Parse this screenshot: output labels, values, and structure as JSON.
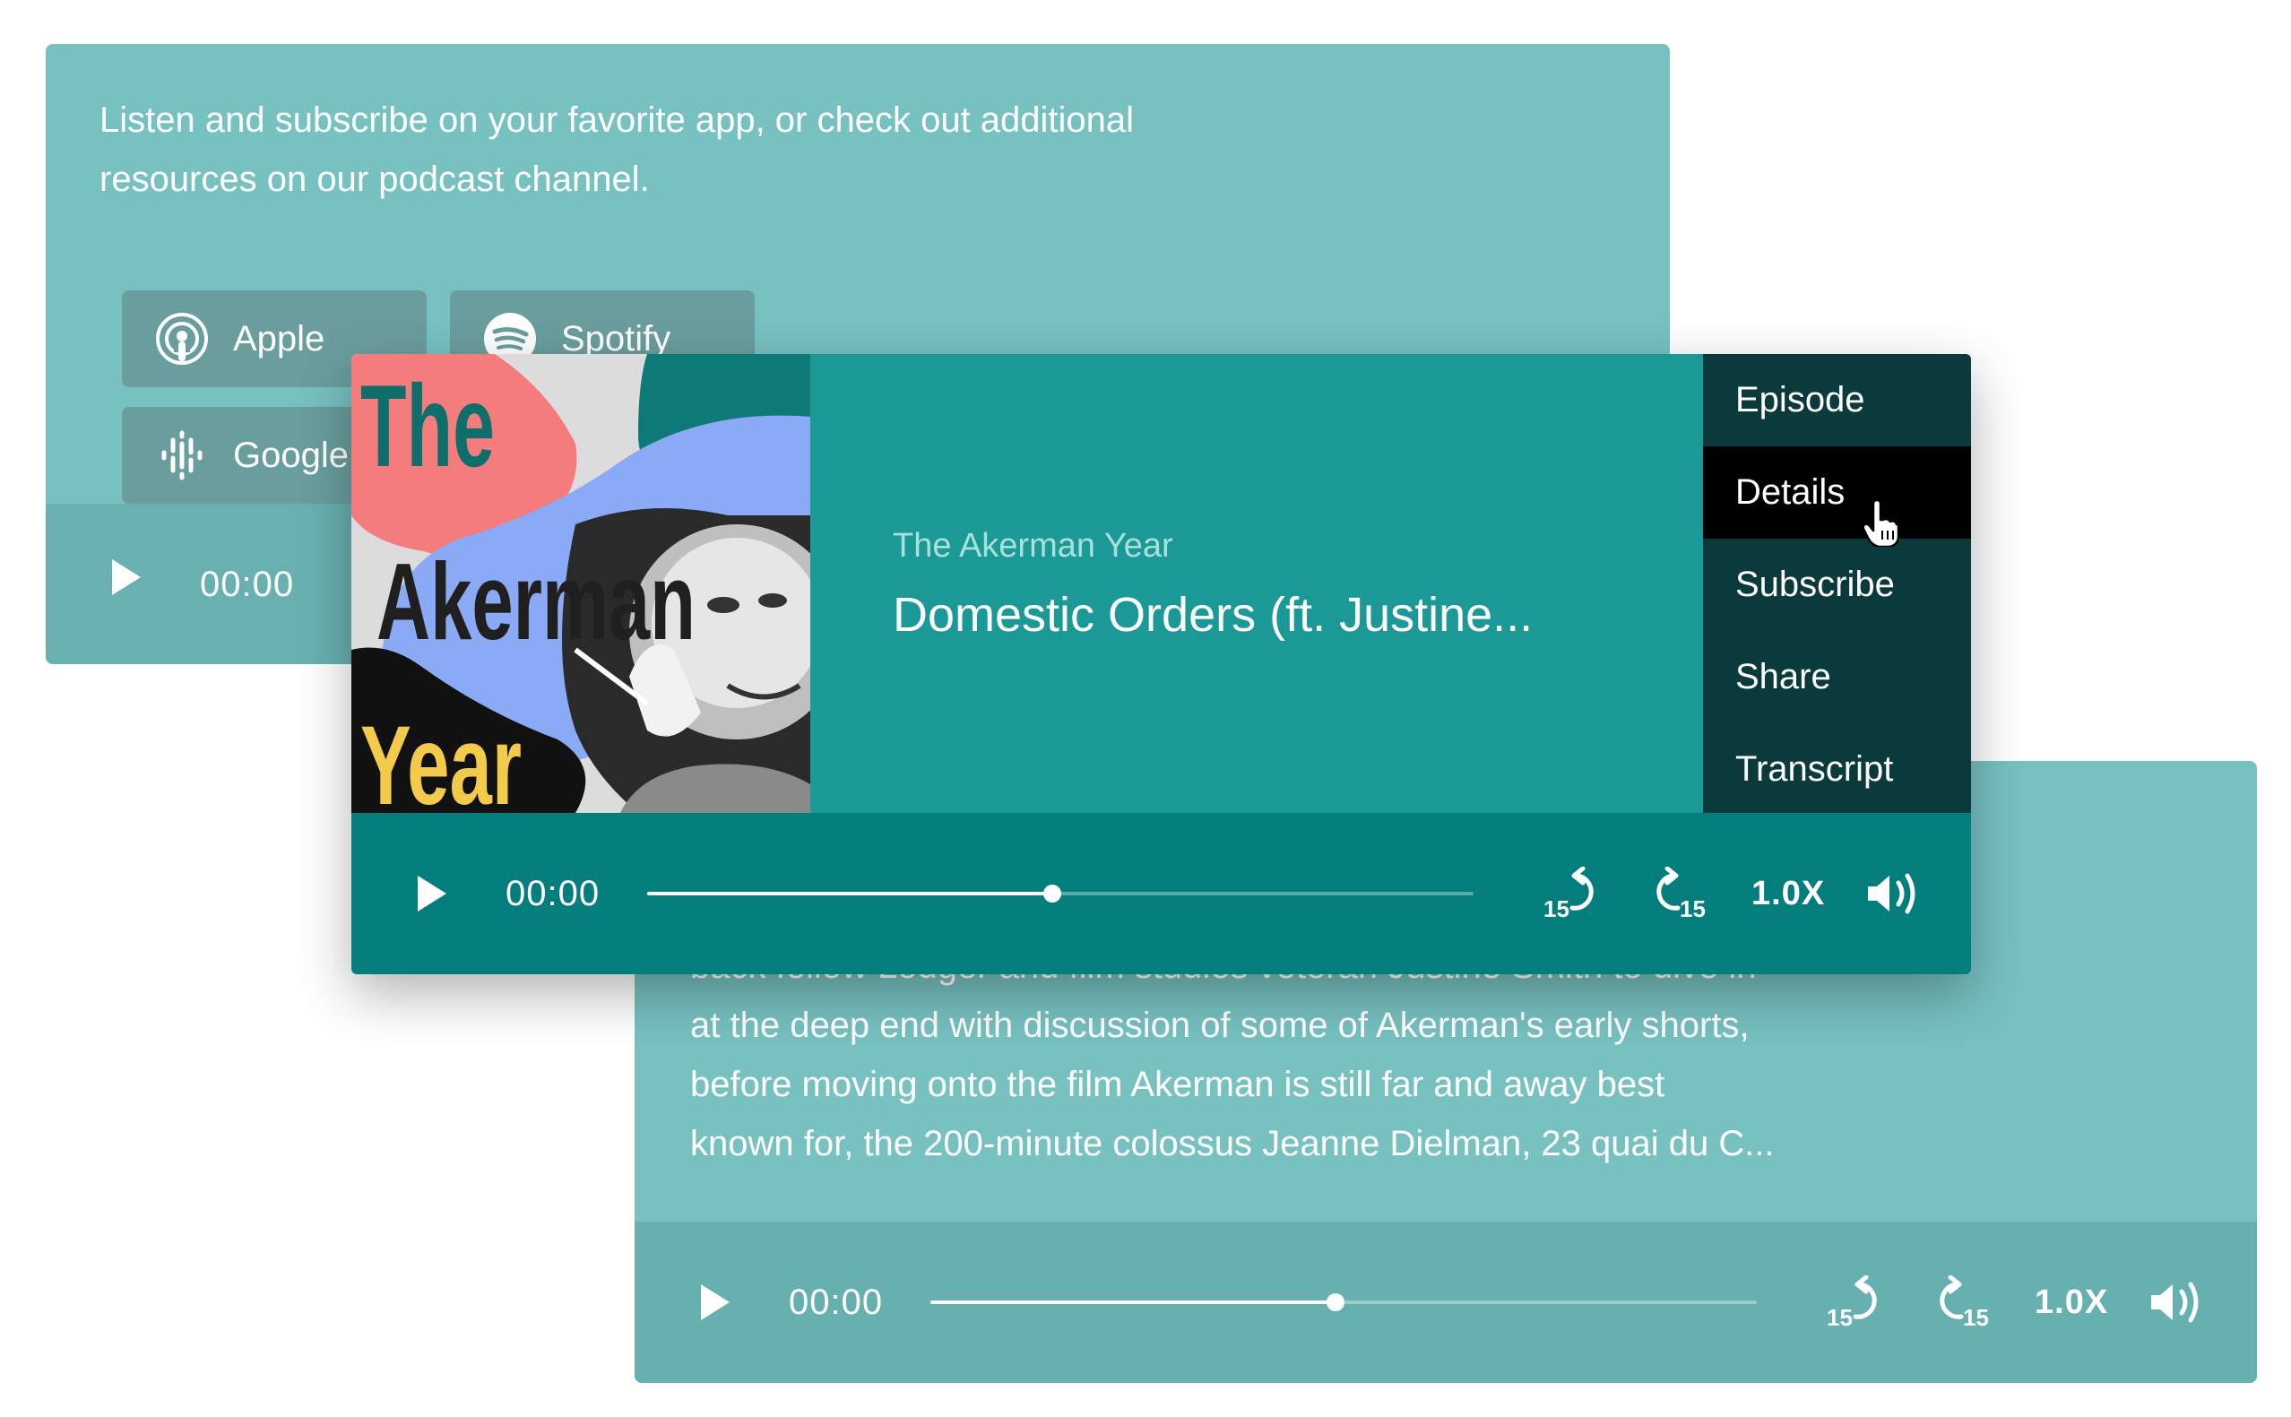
{
  "subscribe_card": {
    "intro_line1": "Listen and subscribe on your favorite app, or check out additional",
    "intro_line2": "resources on our podcast channel.",
    "buttons": [
      {
        "label": "Apple",
        "icon": "podcast-icon"
      },
      {
        "label": "Spotify",
        "icon": "spotify-icon"
      },
      {
        "label": "Google",
        "icon": "google-podcasts-icon"
      }
    ],
    "player": {
      "time": "00:00"
    }
  },
  "description_card": {
    "lines": [
      "back fellow Lodger and film studies veteran Justine Smith to dive in",
      "at the deep end with discussion of some of Akerman's early shorts,",
      "before moving onto the film Akerman is still far and away best",
      "known for, the 200-minute colossus Jeanne Dielman, 23 quai du C..."
    ],
    "player": {
      "time": "00:00",
      "progress": 0.49,
      "rewind": "15",
      "forward": "15",
      "speed": "1.0X"
    }
  },
  "main_player": {
    "artwork": {
      "words": [
        "The",
        "Akerman",
        "Year"
      ]
    },
    "show_title": "The Akerman Year",
    "episode_title": "Domestic Orders (ft. Justine...",
    "menu": [
      {
        "label": "Episode",
        "active": false
      },
      {
        "label": "Details",
        "active": true
      },
      {
        "label": "Subscribe",
        "active": false
      },
      {
        "label": "Share",
        "active": false
      },
      {
        "label": "Transcript",
        "active": false
      }
    ],
    "controls": {
      "time": "00:00",
      "progress": 0.49,
      "rewind": "15",
      "forward": "15",
      "speed": "1.0X"
    }
  },
  "colors": {
    "card_bg": "#77c1c1",
    "main_top": "#1a9996",
    "main_controls": "#047e7c",
    "menu_bg": "#0b3a3c",
    "menu_active": "#000000"
  }
}
